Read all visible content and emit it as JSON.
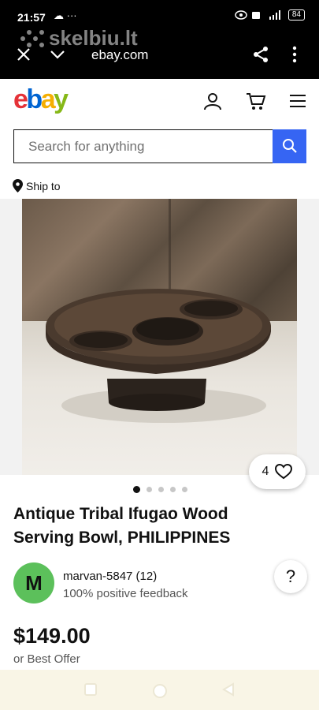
{
  "status": {
    "time": "21:57",
    "battery": "84"
  },
  "browser": {
    "watermark": "skelbiu.lt",
    "url": "ebay.com"
  },
  "header": {
    "logo": [
      "e",
      "b",
      "a",
      "y"
    ],
    "logo_colors": [
      "#e53238",
      "#0064d2",
      "#f5af02",
      "#86b817"
    ]
  },
  "search": {
    "placeholder": "Search for anything"
  },
  "shipto": {
    "label": "Ship to"
  },
  "gallery": {
    "watch_count": "4",
    "image_count": 5,
    "active_index": 0
  },
  "listing": {
    "title": "Antique Tribal Ifugao Wood Serving Bowl, PHILIPPINES",
    "seller_initial": "M",
    "seller_name": "marvan-5847 (12)",
    "seller_feedback": "100% positive feedback",
    "price": "$149.00",
    "offer": "or Best Offer"
  },
  "help": {
    "label": "?"
  },
  "colors": {
    "accent": "#3665f3",
    "avatar": "#5cc05b"
  }
}
